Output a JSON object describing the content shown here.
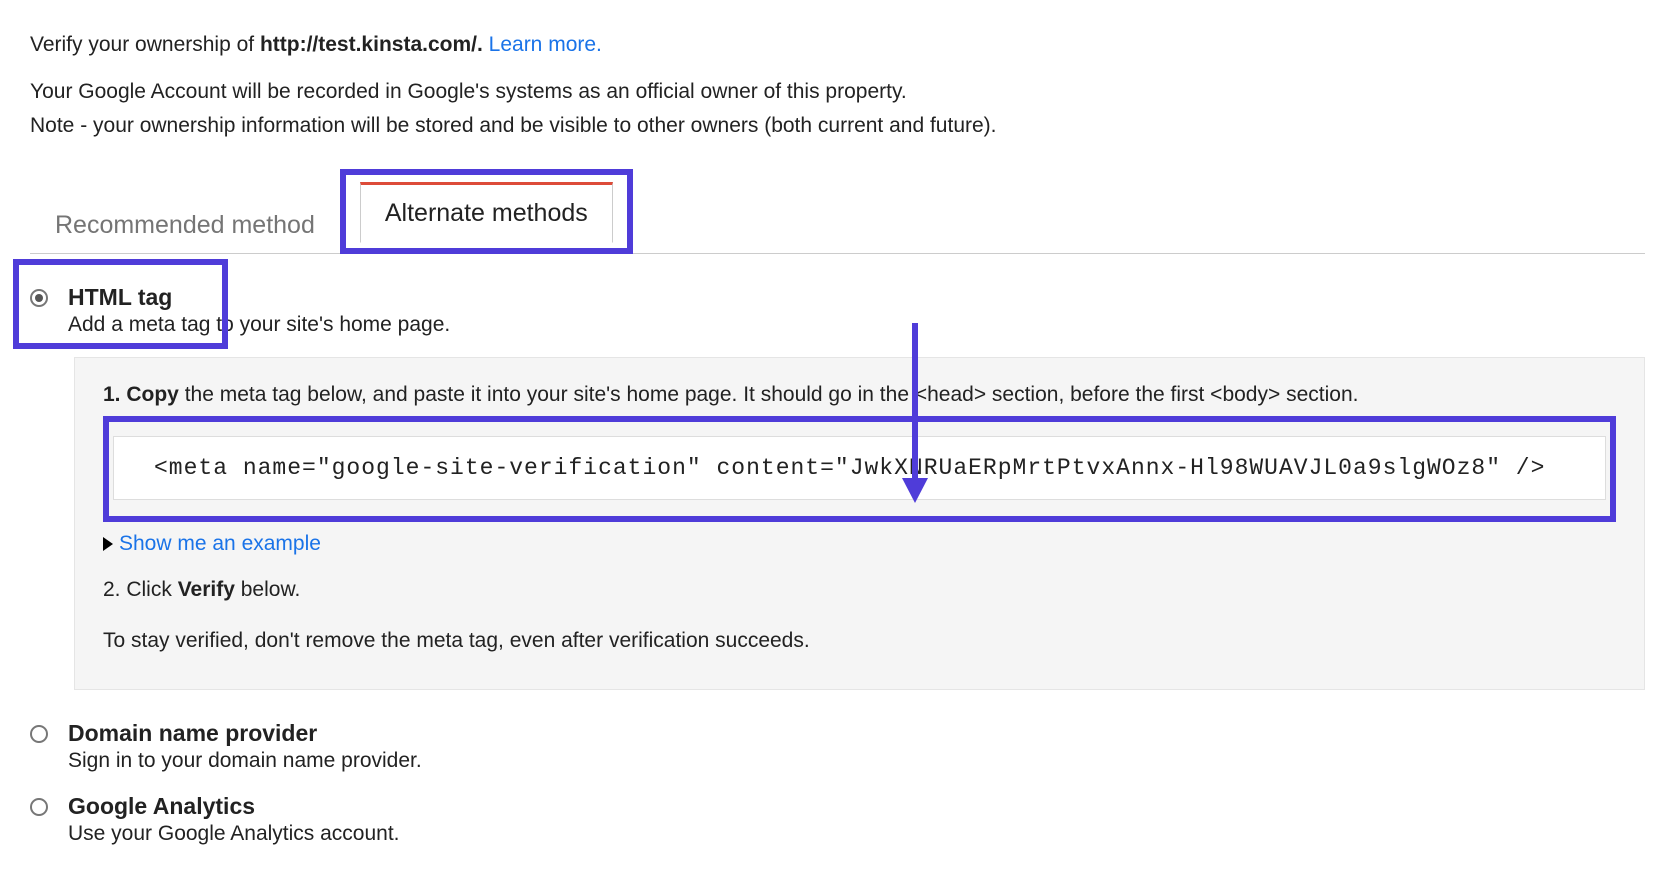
{
  "intro": {
    "verify_prefix": "Verify your ownership of ",
    "url": "http://test.kinsta.com/.",
    "learn_more": "Learn more."
  },
  "recorded": "Your Google Account will be recorded in Google's systems as an official owner of this property.",
  "note": "Note - your ownership information will be stored and be visible to other owners (both current and future).",
  "tabs": {
    "recommended": "Recommended method",
    "alternate": "Alternate methods"
  },
  "options": {
    "html_tag": {
      "title": "HTML tag",
      "desc": "Add a meta tag to your site's home page."
    },
    "domain": {
      "title": "Domain name provider",
      "desc": "Sign in to your domain name provider."
    },
    "analytics": {
      "title": "Google Analytics",
      "desc": "Use your Google Analytics account."
    }
  },
  "panel": {
    "step1_num": "1.",
    "step1_bold": "Copy",
    "step1_rest": " the meta tag below, and paste it into your site's home page. It should go in the <head> section, before the first <body> section.",
    "code": "<meta name=\"google-site-verification\" content=\"JwkXNRUaERpMrtPtvxAnnx-Hl98WUAVJL0a9slgWOz8\" />",
    "show_example": "Show me an example",
    "step2_prefix": "2. Click ",
    "step2_bold": "Verify",
    "step2_suffix": " below.",
    "stay": "To stay verified, don't remove the meta tag, even after verification succeeds."
  }
}
